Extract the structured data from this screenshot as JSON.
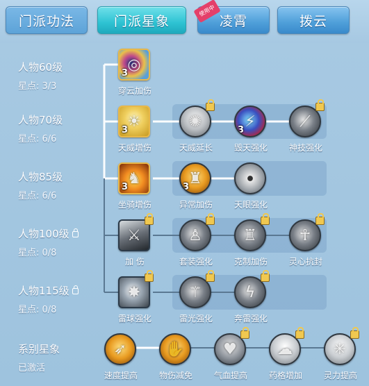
{
  "tabs": [
    {
      "label": "门派功法"
    },
    {
      "label": "门派星象"
    },
    {
      "label": "凌霄",
      "badge": "使用中"
    },
    {
      "label": "拨云"
    }
  ],
  "rows": [
    {
      "title": "人物60级",
      "stars": "星点: 3/3",
      "locked": false
    },
    {
      "title": "人物70级",
      "stars": "星点: 6/6",
      "locked": false
    },
    {
      "title": "人物85级",
      "stars": "星点: 6/6",
      "locked": false
    },
    {
      "title": "人物100级",
      "stars": "星点: 0/8",
      "locked": true
    },
    {
      "title": "人物115级",
      "stars": "星点: 0/8",
      "locked": true
    }
  ],
  "nodes": {
    "r1": [
      {
        "label": "穿云加伤",
        "level": "3",
        "icon": "swirl-icon"
      }
    ],
    "r2": [
      {
        "label": "天威增伤",
        "level": "3",
        "icon": "sun-rays-icon"
      },
      {
        "label": "天威延长",
        "level": "",
        "icon": "shell-icon",
        "locked": true
      },
      {
        "label": "毁天强化",
        "level": "3",
        "icon": "lightning-fire-icon"
      },
      {
        "label": "神技强化",
        "level": "",
        "icon": "blade-icon",
        "locked": true
      }
    ],
    "r3": [
      {
        "label": "坐骑增伤",
        "level": "3",
        "icon": "fire-beast-icon"
      },
      {
        "label": "异常加伤",
        "level": "3",
        "icon": "warrior-icon"
      },
      {
        "label": "天眼强化",
        "level": "",
        "icon": "eye-icon"
      }
    ],
    "r4": [
      {
        "label": "加 伤",
        "icon": "swordsman-icon",
        "locked": true
      },
      {
        "label": "套装强化",
        "icon": "figure-icon",
        "locked": true
      },
      {
        "label": "克制加伤",
        "icon": "fighter-icon",
        "locked": true
      },
      {
        "label": "灵心抗封",
        "icon": "runner-icon",
        "locked": true
      }
    ],
    "r5": [
      {
        "label": "雷球强化",
        "icon": "thunder-orb-icon",
        "locked": true
      },
      {
        "label": "雷光强化",
        "icon": "thunder-blade-icon",
        "locked": true
      },
      {
        "label": "奔雷强化",
        "icon": "lightning-bolt-icon",
        "locked": true
      }
    ]
  },
  "series": {
    "title": "系别星象",
    "status": "已激活",
    "items": [
      {
        "label": "速度提高",
        "icon": "speed-icon"
      },
      {
        "label": "物伤减免",
        "icon": "shield-hand-icon"
      },
      {
        "label": "气血提高",
        "icon": "heart-icon",
        "locked": true
      },
      {
        "label": "药格增加",
        "icon": "potion-icon",
        "locked": true
      },
      {
        "label": "灵力提高",
        "icon": "spirit-icon",
        "locked": true
      }
    ]
  }
}
